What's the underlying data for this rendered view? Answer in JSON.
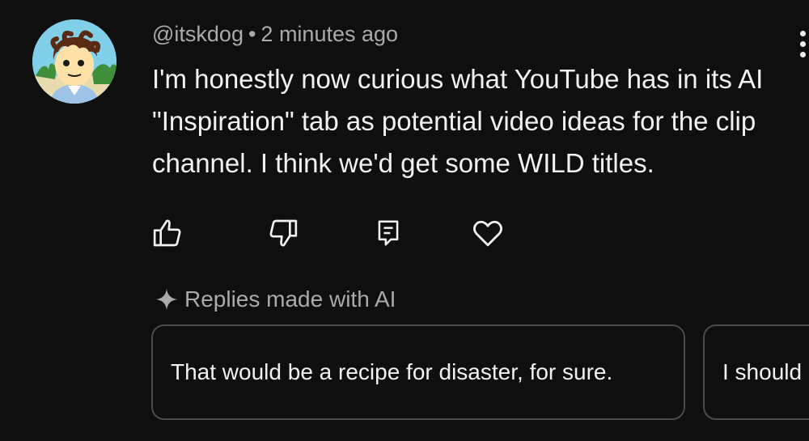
{
  "comment": {
    "author": "@itskdog",
    "separator": "•",
    "timestamp": "2 minutes ago",
    "text": "I'm honestly now curious what YouTube has in its AI \"Inspiration\" tab as potential video ideas for the clip channel. I think we'd get some WILD titles."
  },
  "actions": {
    "like_icon": "thumbs-up-icon",
    "dislike_icon": "thumbs-down-icon",
    "reply_icon": "comment-icon",
    "heart_icon": "heart-icon"
  },
  "ai_replies": {
    "label": "Replies made with AI",
    "icon": "sparkle-icon",
    "suggestions": [
      "That would be a recipe for disaster, for sure.",
      "I should"
    ]
  },
  "colors": {
    "background": "#0f0f0f",
    "primary_text": "#f1f1f1",
    "secondary_text": "#aaaaaa",
    "chip_border": "#4a4a4a"
  }
}
